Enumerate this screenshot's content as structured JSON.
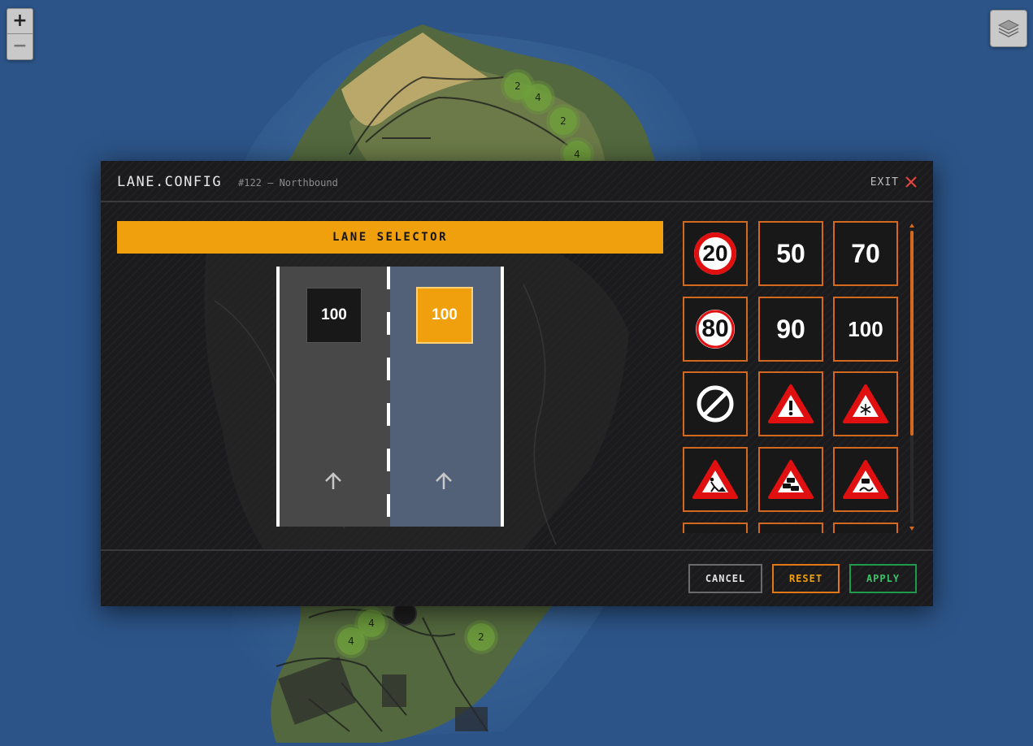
{
  "map": {
    "zoom_in": "+",
    "zoom_out": "−",
    "layers_icon": "layers-icon",
    "clusters": [
      "2",
      "4",
      "2",
      "4",
      "4",
      "4",
      "2"
    ]
  },
  "modal": {
    "title": "LANE.CONFIG",
    "subtitle": "#122 — Northbound",
    "exit_label": "EXIT",
    "lane_selector_label": "LANE SELECTOR",
    "lanes": [
      {
        "sign": "100",
        "selected": false
      },
      {
        "sign": "100",
        "selected": true
      }
    ],
    "signs": [
      {
        "id": "speed-20",
        "type": "speed-ring",
        "text": "20"
      },
      {
        "id": "speed-50",
        "type": "speed-plain",
        "text": "50"
      },
      {
        "id": "speed-70",
        "type": "speed-plain",
        "text": "70"
      },
      {
        "id": "speed-80",
        "type": "speed-ring",
        "text": "80"
      },
      {
        "id": "speed-90",
        "type": "speed-plain",
        "text": "90"
      },
      {
        "id": "speed-100",
        "type": "speed-plain",
        "text": "100"
      },
      {
        "id": "end-restriction",
        "type": "icon",
        "icon": "no-entry-circle-icon"
      },
      {
        "id": "danger",
        "type": "icon",
        "icon": "warning-triangle-icon"
      },
      {
        "id": "snow",
        "type": "icon",
        "icon": "snow-warning-icon"
      },
      {
        "id": "roadworks",
        "type": "icon",
        "icon": "roadworks-icon"
      },
      {
        "id": "traffic-jam",
        "type": "icon",
        "icon": "traffic-jam-icon"
      },
      {
        "id": "slippery",
        "type": "icon",
        "icon": "slippery-road-icon"
      }
    ],
    "buttons": {
      "cancel": "CANCEL",
      "reset": "RESET",
      "apply": "APPLY"
    },
    "colors": {
      "accent": "#f0a00c",
      "border": "#d2691e",
      "apply": "#1e9a4a",
      "selected_lane": "#526078"
    }
  }
}
